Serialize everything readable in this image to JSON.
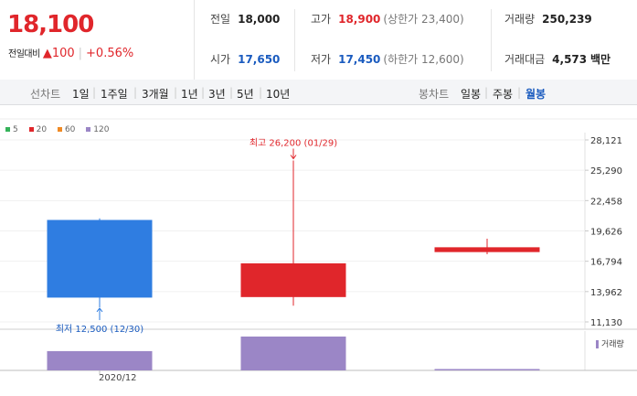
{
  "quote": {
    "current_price": "18,100",
    "change_label": "전일대비",
    "change_symbol": "▲",
    "change_value": "100",
    "change_percent": "+0.56%"
  },
  "stats": {
    "prev_close_label": "전일",
    "prev_close": "18,000",
    "high_label": "고가",
    "high": "18,900",
    "upper_limit_text": "(상한가 23,400)",
    "volume_label": "거래량",
    "volume": "250,239",
    "open_label": "시가",
    "open": "17,650",
    "low_label": "저가",
    "low": "17,450",
    "lower_limit_text": "(하한가 12,600)",
    "trade_value_label": "거래대금",
    "trade_value": "4,573",
    "trade_value_unit": "백만"
  },
  "tabs": {
    "line_label": "선차트",
    "line_items": [
      "1일",
      "1주일",
      "3개월",
      "1년",
      "3년",
      "5년",
      "10년"
    ],
    "candle_label": "봉차트",
    "candle_items": [
      "일봉",
      "주봉",
      "월봉"
    ],
    "active_candle": "월봉"
  },
  "legend": [
    {
      "label": "5",
      "color": "#35b35a"
    },
    {
      "label": "20",
      "color": "#e0262b"
    },
    {
      "label": "60",
      "color": "#f08a24"
    },
    {
      "label": "120",
      "color": "#9b86c6"
    }
  ],
  "colors": {
    "up": "#e0262b",
    "down": "#2f7de1",
    "volume": "#9b86c6"
  },
  "chart_data": {
    "type": "candlestick",
    "y_ticks": [
      "28,121",
      "25,290",
      "22,458",
      "19,626",
      "16,794",
      "13,962",
      "11,130"
    ],
    "ylim": [
      11130,
      28121
    ],
    "x_tick_label": "2020/12",
    "candles": [
      {
        "open": 20650,
        "close": 13400,
        "high": 20800,
        "low": 12500,
        "volume": 0.57
      },
      {
        "open": 13450,
        "close": 16600,
        "high": 26200,
        "low": 12650,
        "volume": 1.0
      },
      {
        "open": 17650,
        "close": 18100,
        "high": 18900,
        "low": 17450,
        "volume": 0.04
      }
    ],
    "max_annotation": "최고 26,200 (01/29)",
    "min_annotation": "최저 12,500 (12/30)",
    "volume_legend": "거래량"
  }
}
